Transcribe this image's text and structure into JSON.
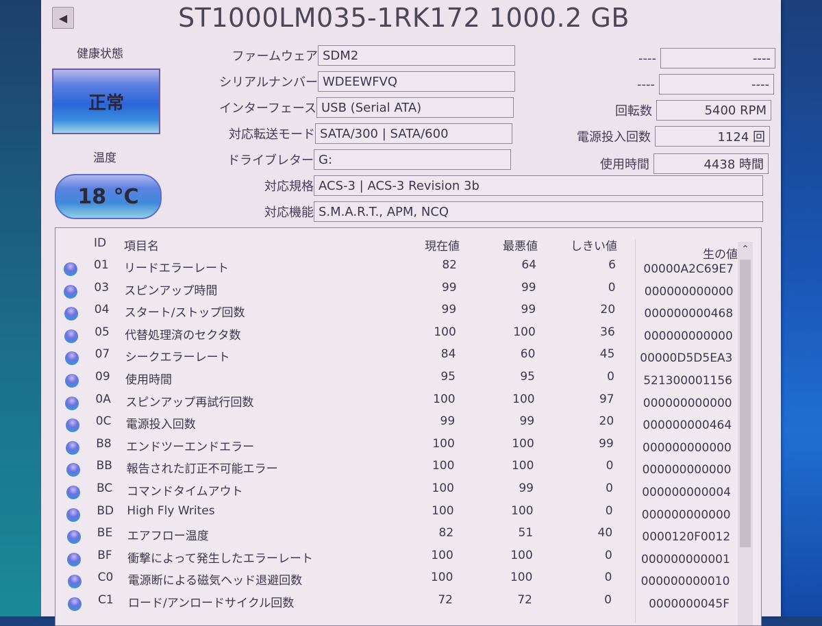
{
  "title": "ST1000LM035-1RK172 1000.2 GB",
  "back_icon": "◀",
  "health": {
    "label": "健康状態",
    "status": "正常"
  },
  "temperature": {
    "label": "温度",
    "value": "18 °C"
  },
  "info_left": [
    {
      "label": "ファームウェア",
      "value": "SDM2"
    },
    {
      "label": "シリアルナンバー",
      "value": "WDEEWFVQ"
    },
    {
      "label": "インターフェース",
      "value": "USB (Serial ATA)"
    },
    {
      "label": "対応転送モード",
      "value": "SATA/300 | SATA/600"
    },
    {
      "label": "ドライブレター",
      "value": "G:"
    }
  ],
  "info_wide": [
    {
      "label": "対応規格",
      "value": "ACS-3 | ACS-3 Revision 3b"
    },
    {
      "label": "対応機能",
      "value": "S.M.A.R.T., APM, NCQ"
    }
  ],
  "info_right": [
    {
      "label": "----",
      "value": "----"
    },
    {
      "label": "----",
      "value": "----"
    },
    {
      "label": "回転数",
      "value": "5400 RPM"
    },
    {
      "label": "電源投入回数",
      "value": "1124 回"
    },
    {
      "label": "使用時間",
      "value": "4438 時間"
    }
  ],
  "smart": {
    "headers": {
      "id": "ID",
      "name": "項目名",
      "current": "現在値",
      "worst": "最悪値",
      "threshold": "しきい値",
      "raw": "生の値"
    },
    "scroll_up_icon": "⌃",
    "rows": [
      {
        "id": "01",
        "name": "リードエラーレート",
        "current": "82",
        "worst": "64",
        "threshold": "6",
        "raw": "00000A2C69E7"
      },
      {
        "id": "03",
        "name": "スピンアップ時間",
        "current": "99",
        "worst": "99",
        "threshold": "0",
        "raw": "000000000000"
      },
      {
        "id": "04",
        "name": "スタート/ストップ回数",
        "current": "99",
        "worst": "99",
        "threshold": "20",
        "raw": "000000000468"
      },
      {
        "id": "05",
        "name": "代替処理済のセクタ数",
        "current": "100",
        "worst": "100",
        "threshold": "36",
        "raw": "000000000000"
      },
      {
        "id": "07",
        "name": "シークエラーレート",
        "current": "84",
        "worst": "60",
        "threshold": "45",
        "raw": "00000D5D5EA3"
      },
      {
        "id": "09",
        "name": "使用時間",
        "current": "95",
        "worst": "95",
        "threshold": "0",
        "raw": "521300001156"
      },
      {
        "id": "0A",
        "name": "スピンアップ再試行回数",
        "current": "100",
        "worst": "100",
        "threshold": "97",
        "raw": "000000000000"
      },
      {
        "id": "0C",
        "name": "電源投入回数",
        "current": "99",
        "worst": "99",
        "threshold": "20",
        "raw": "000000000464"
      },
      {
        "id": "B8",
        "name": "エンドツーエンドエラー",
        "current": "100",
        "worst": "100",
        "threshold": "99",
        "raw": "000000000000"
      },
      {
        "id": "BB",
        "name": "報告された訂正不可能エラー",
        "current": "100",
        "worst": "100",
        "threshold": "0",
        "raw": "000000000000"
      },
      {
        "id": "BC",
        "name": "コマンドタイムアウト",
        "current": "100",
        "worst": "99",
        "threshold": "0",
        "raw": "000000000004"
      },
      {
        "id": "BD",
        "name": "High Fly Writes",
        "current": "100",
        "worst": "100",
        "threshold": "0",
        "raw": "000000000000"
      },
      {
        "id": "BE",
        "name": "エアフロー温度",
        "current": "82",
        "worst": "51",
        "threshold": "40",
        "raw": "0000120F0012"
      },
      {
        "id": "BF",
        "name": "衝撃によって発生したエラーレート",
        "current": "100",
        "worst": "100",
        "threshold": "0",
        "raw": "000000000001"
      },
      {
        "id": "C0",
        "name": "電源断による磁気ヘッド退避回数",
        "current": "100",
        "worst": "100",
        "threshold": "0",
        "raw": "000000000010"
      },
      {
        "id": "C1",
        "name": "ロード/アンロードサイクル回数",
        "current": "72",
        "worst": "72",
        "threshold": "0",
        "raw": "0000000045F"
      }
    ]
  }
}
